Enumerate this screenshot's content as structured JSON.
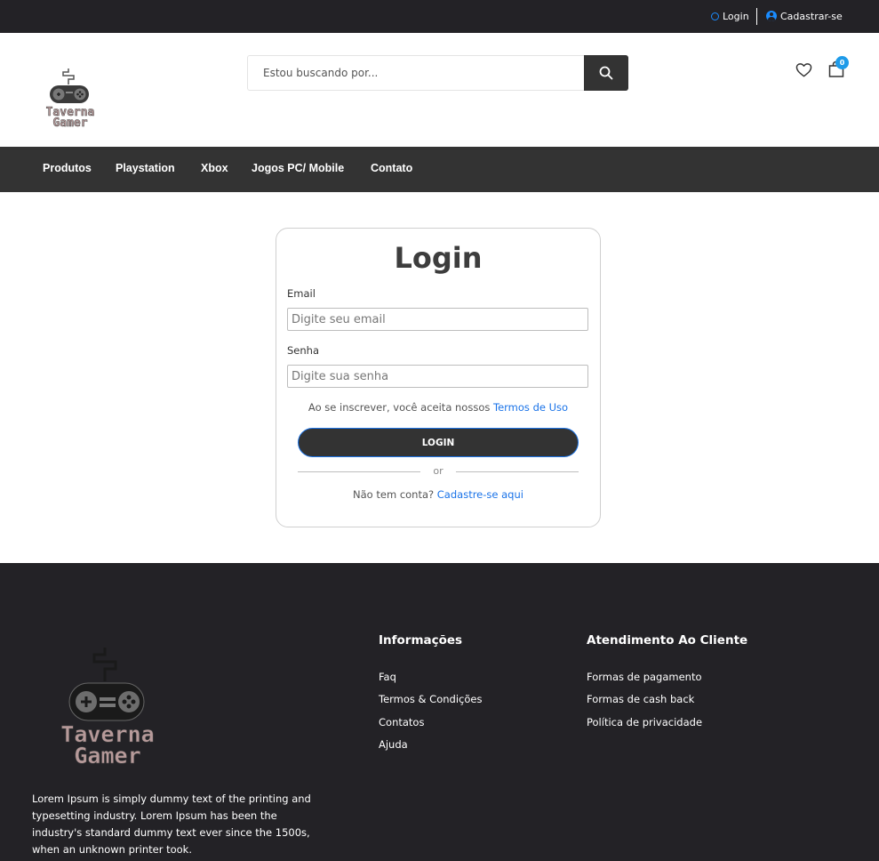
{
  "topbar": {
    "login_label": "Login",
    "signup_label": "Cadastrar-se"
  },
  "header": {
    "logo_text_line1": "Taverna",
    "logo_text_line2": "Gamer",
    "search_placeholder": "Estou buscando por...",
    "cart_count": "0"
  },
  "nav": {
    "items": [
      {
        "label": "Produtos"
      },
      {
        "label": "Playstation"
      },
      {
        "label": "Xbox"
      },
      {
        "label": "Jogos PC/ Mobile"
      },
      {
        "label": "Contato"
      }
    ]
  },
  "login_form": {
    "title": "Login",
    "email_label": "Email",
    "email_placeholder": "Digite seu email",
    "password_label": "Senha",
    "password_placeholder": "Digite sua senha",
    "terms_text": "Ao se inscrever, você aceita nossos",
    "terms_link": "Termos de Uso",
    "submit_label": "LOGIN",
    "or_text": "or",
    "no_account_text": "Não tem conta?",
    "signup_link": "Cadastre-se aqui"
  },
  "footer": {
    "logo_text_line1": "Taverna",
    "logo_text_line2": "Gamer",
    "description": "Lorem Ipsum is simply dummy text of the printing and typesetting industry. Lorem Ipsum has been the industry's standard dummy text ever since the 1500s, when an unknown printer took.",
    "info_title": "Informações",
    "info_links": [
      "Faq",
      "Termos & Condições",
      "Contatos",
      "Ajuda"
    ],
    "service_title": "Atendimento Ao Cliente",
    "service_links": [
      "Formas de pagamento",
      "Formas de cash back",
      "Política de privacidade"
    ]
  },
  "colors": {
    "dark_bar": "#232226",
    "nav_bg": "#333333",
    "accent_blue": "#1a73e8",
    "badge_blue": "#1e9be9"
  }
}
